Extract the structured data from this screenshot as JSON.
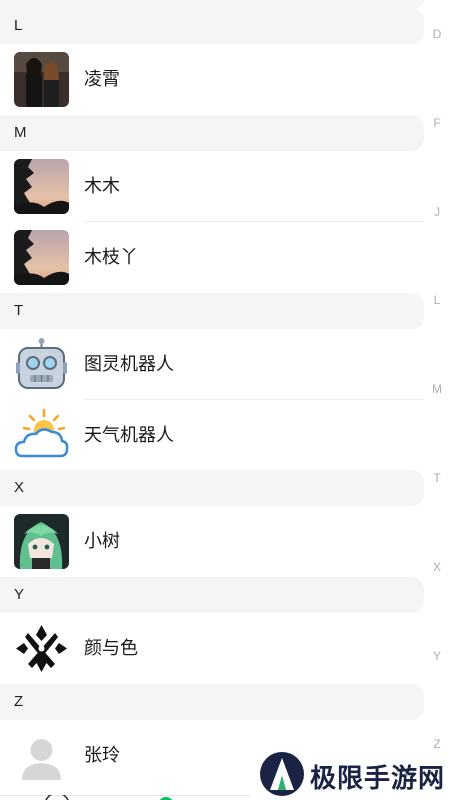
{
  "index_letters": [
    "D",
    "F",
    "J",
    "L",
    "M",
    "T",
    "X",
    "Y",
    "Z"
  ],
  "groups": [
    {
      "letter": "L",
      "contacts": [
        {
          "name": "凌霄",
          "avatar": "photo-two-people"
        }
      ]
    },
    {
      "letter": "M",
      "contacts": [
        {
          "name": "木木",
          "avatar": "photo-sunset-trees"
        },
        {
          "name": "木枝丫",
          "avatar": "photo-sunset-trees"
        }
      ]
    },
    {
      "letter": "T",
      "contacts": [
        {
          "name": "图灵机器人",
          "avatar": "robot-icon"
        },
        {
          "name": "天气机器人",
          "avatar": "weather-icon"
        }
      ]
    },
    {
      "letter": "X",
      "contacts": [
        {
          "name": "小树",
          "avatar": "anime-green-hair"
        }
      ]
    },
    {
      "letter": "Y",
      "contacts": [
        {
          "name": "颜与色",
          "avatar": "black-emblem-icon"
        }
      ]
    },
    {
      "letter": "Z",
      "contacts": [
        {
          "name": "张玲",
          "avatar": "default-person-icon"
        }
      ]
    }
  ],
  "watermark": {
    "text": "极限手游网"
  },
  "colors": {
    "header_bg": "#f5f5f5",
    "index_text": "#b0b0b0",
    "tab_active": "#07c160"
  }
}
